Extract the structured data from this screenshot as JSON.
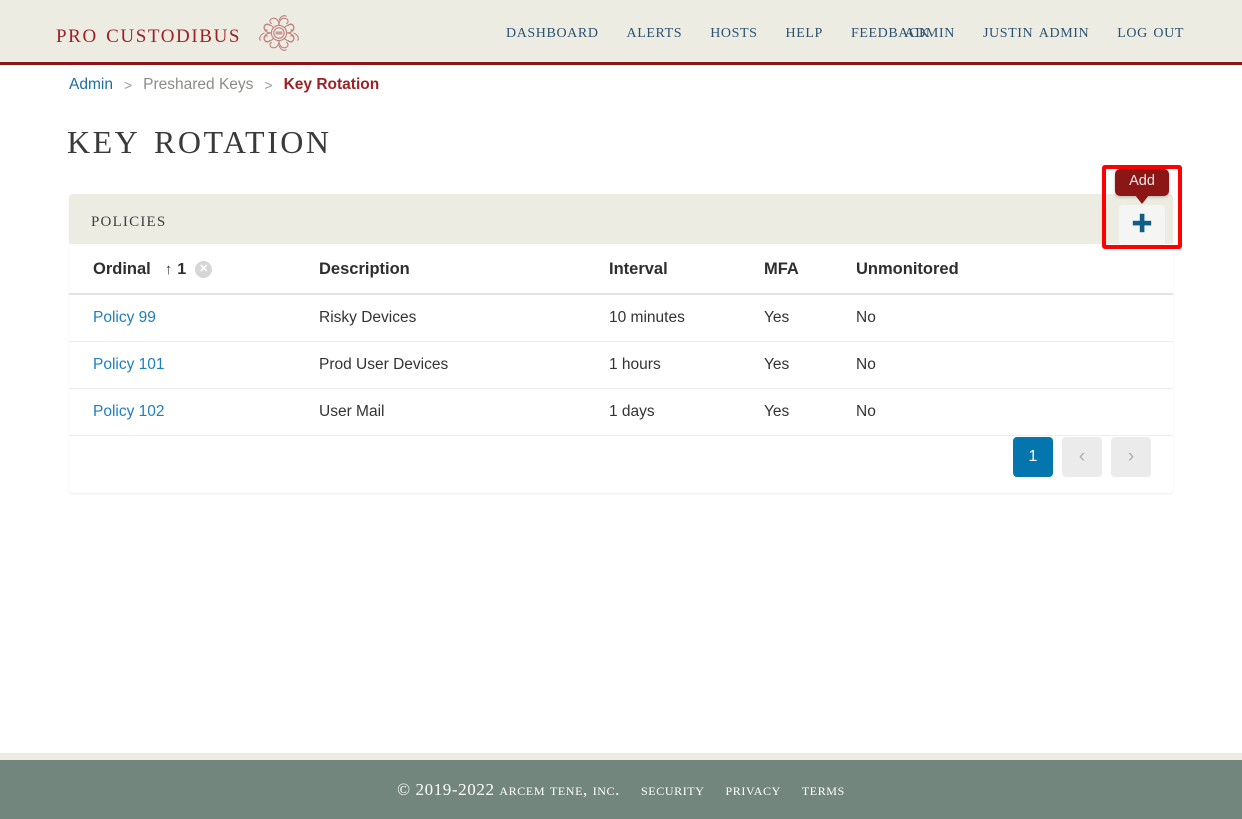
{
  "header": {
    "brand": {
      "text": "Pro Custodibus",
      "logo_icon": "medusa-logo-icon"
    },
    "nav_main": [
      {
        "label": "Dashboard",
        "name": "nav-dashboard"
      },
      {
        "label": "Alerts",
        "name": "nav-alerts"
      },
      {
        "label": "Hosts",
        "name": "nav-hosts"
      },
      {
        "label": "Help",
        "name": "nav-help"
      },
      {
        "label": "Feedback",
        "name": "nav-feedback"
      }
    ],
    "nav_right": [
      {
        "label": "Admin",
        "name": "nav-admin"
      },
      {
        "label": "Justin Admin",
        "name": "nav-user"
      },
      {
        "label": "Log Out",
        "name": "nav-logout"
      }
    ]
  },
  "breadcrumb": {
    "items": [
      {
        "label": "Admin",
        "type": "link"
      },
      {
        "label": "Preshared Keys",
        "type": "muted"
      },
      {
        "label": "Key Rotation",
        "type": "current"
      }
    ],
    "separator": ">"
  },
  "page": {
    "title": "Key Rotation"
  },
  "add_control": {
    "tooltip": "Add",
    "icon": "plus-icon",
    "highlighted": true,
    "highlight_color": "#FF0000"
  },
  "card": {
    "title": "Policies",
    "table": {
      "columns": [
        {
          "label": "Ordinal",
          "key": "ordinal",
          "sorted": true,
          "sort_direction": "↑",
          "sort_order": "1",
          "clear_icon": "✕"
        },
        {
          "label": "Description",
          "key": "description"
        },
        {
          "label": "Interval",
          "key": "interval"
        },
        {
          "label": "MFA",
          "key": "mfa"
        },
        {
          "label": "Unmonitored",
          "key": "unmonitored"
        }
      ],
      "rows": [
        {
          "ordinal": "Policy 99",
          "description": "Risky Devices",
          "interval": "10 minutes",
          "mfa": "Yes",
          "unmonitored": "No"
        },
        {
          "ordinal": "Policy 101",
          "description": "Prod User Devices",
          "interval": "1 hours",
          "mfa": "Yes",
          "unmonitored": "No"
        },
        {
          "ordinal": "Policy 102",
          "description": "User Mail",
          "interval": "1 days",
          "mfa": "Yes",
          "unmonitored": "No"
        }
      ]
    },
    "pagination": {
      "current_page": "1",
      "prev_icon": "‹",
      "next_icon": "›",
      "prev_disabled": true,
      "next_disabled": true
    }
  },
  "footer": {
    "copyright": "© 2019-2022 Arcem Tene, Inc.",
    "links": [
      {
        "label": "Security"
      },
      {
        "label": "Privacy"
      },
      {
        "label": "Terms"
      }
    ]
  },
  "colors": {
    "brand_red": "#9B2226",
    "header_bg": "#EDECE3",
    "nav_blue": "#2B5272",
    "link_blue": "#1C7FBE",
    "footer_bg": "#72867D",
    "accent_blue": "#0476AD",
    "tooltip_bg": "#8C1515"
  }
}
